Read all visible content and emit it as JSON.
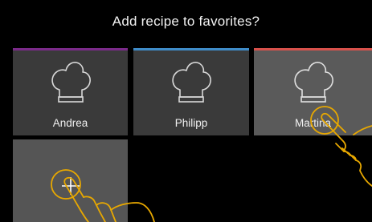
{
  "dialog": {
    "title": "Add recipe to favorites?"
  },
  "profiles": [
    {
      "name": "Andrea",
      "color": "#7b2a8a"
    },
    {
      "name": "Philipp",
      "color": "#3f8cc9"
    },
    {
      "name": "Martina",
      "color": "#d9514b"
    }
  ],
  "add_profile": {
    "icon": "plus-icon"
  },
  "gesture": {
    "color": "#e8a800",
    "icon": "tap-hand-icon"
  }
}
